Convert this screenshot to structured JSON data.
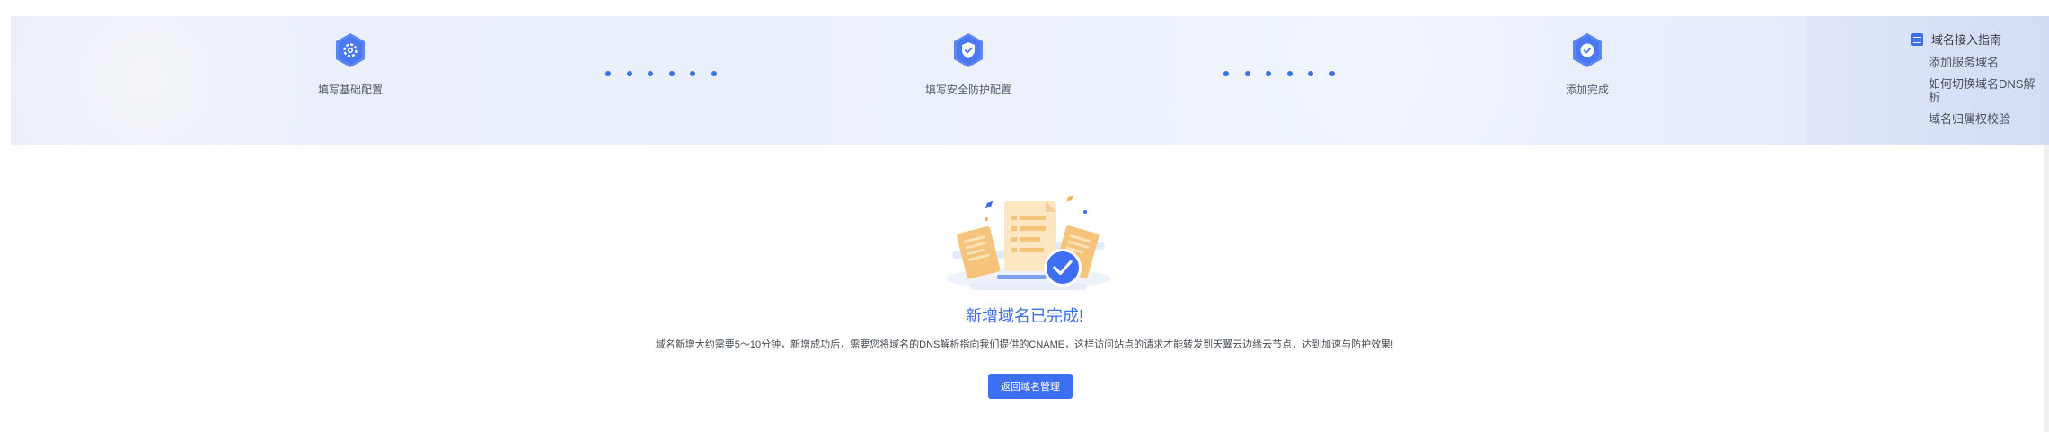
{
  "steps": {
    "step1": {
      "label": "填写基础配置",
      "icon": "gear-icon"
    },
    "step2": {
      "label": "填写安全防护配置",
      "icon": "shield-check-icon"
    },
    "step3": {
      "label": "添加完成",
      "icon": "check-circle-icon"
    }
  },
  "guide": {
    "title": "域名接入指南",
    "links": [
      "添加服务域名",
      "如何切换域名DNS解析",
      "域名归属权校验"
    ]
  },
  "result": {
    "title": "新增域名已完成!",
    "description": "域名新增大约需要5～10分钟，新增成功后，需要您将域名的DNS解析指向我们提供的CNAME，这样访问站点的请求才能转发到天翼云边缘云节点，达到加速与防护效果!",
    "button_label": "返回域名管理"
  },
  "colors": {
    "accent": "#3e6ef2",
    "step_icon": "#5b86f5"
  }
}
